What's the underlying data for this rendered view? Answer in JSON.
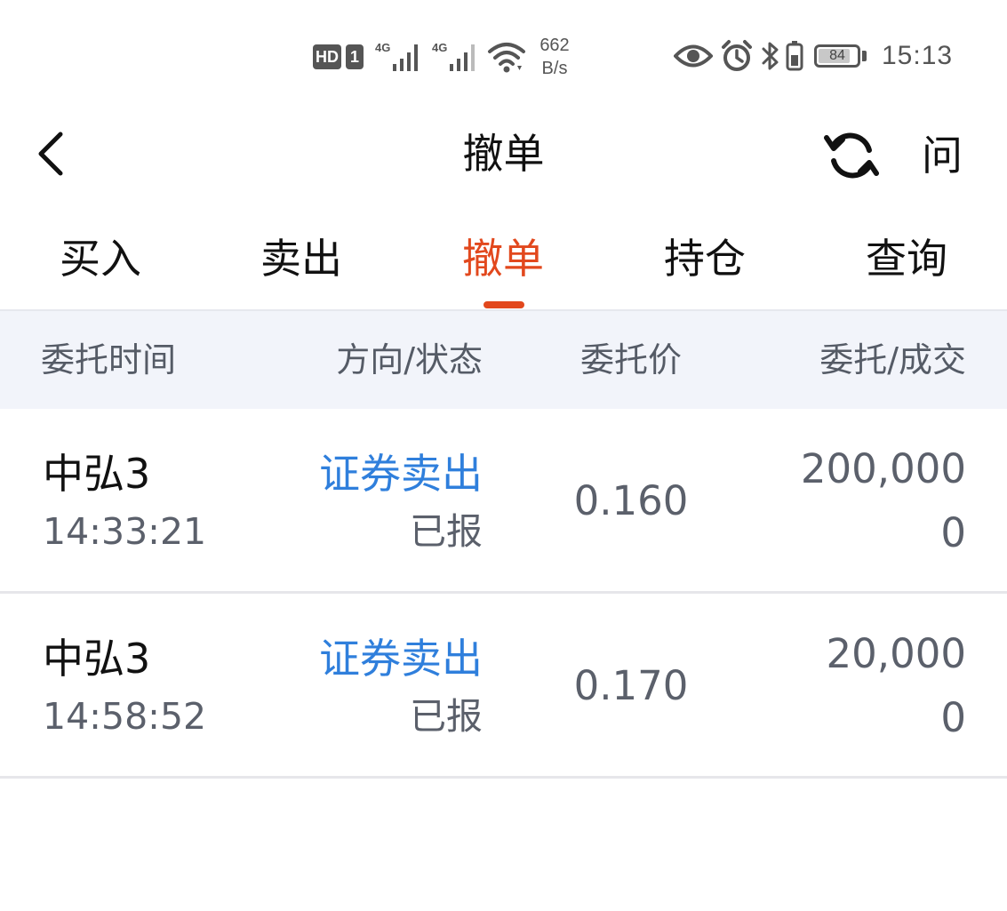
{
  "status_bar": {
    "hd": "HD",
    "sim": "1",
    "net1": "4G",
    "net2": "4G",
    "speed_value": "662",
    "speed_unit": "B/s",
    "battery": "84",
    "battery_level": 0.84,
    "time": "15:13"
  },
  "nav": {
    "title": "撤单",
    "ask_label": "问",
    "back_icon": "chevron-left-icon",
    "refresh_icon": "refresh-icon"
  },
  "tabs": [
    {
      "label": "买入",
      "active": false
    },
    {
      "label": "卖出",
      "active": false
    },
    {
      "label": "撤单",
      "active": true
    },
    {
      "label": "持仓",
      "active": false
    },
    {
      "label": "查询",
      "active": false
    }
  ],
  "table": {
    "headers": [
      "委托时间",
      "方向/状态",
      "委托价",
      "委托/成交"
    ],
    "rows": [
      {
        "name": "中弘3",
        "time": "14:33:21",
        "direction": "证券卖出",
        "status": "已报",
        "price": "0.160",
        "order_qty": "200,000",
        "filled_qty": "0"
      },
      {
        "name": "中弘3",
        "time": "14:58:52",
        "direction": "证券卖出",
        "status": "已报",
        "price": "0.170",
        "order_qty": "20,000",
        "filled_qty": "0"
      }
    ]
  },
  "colors": {
    "accent": "#e2481d",
    "direction_blue": "#2f7fdc",
    "header_bg": "#f2f4fa",
    "muted_text": "#5b606b"
  }
}
